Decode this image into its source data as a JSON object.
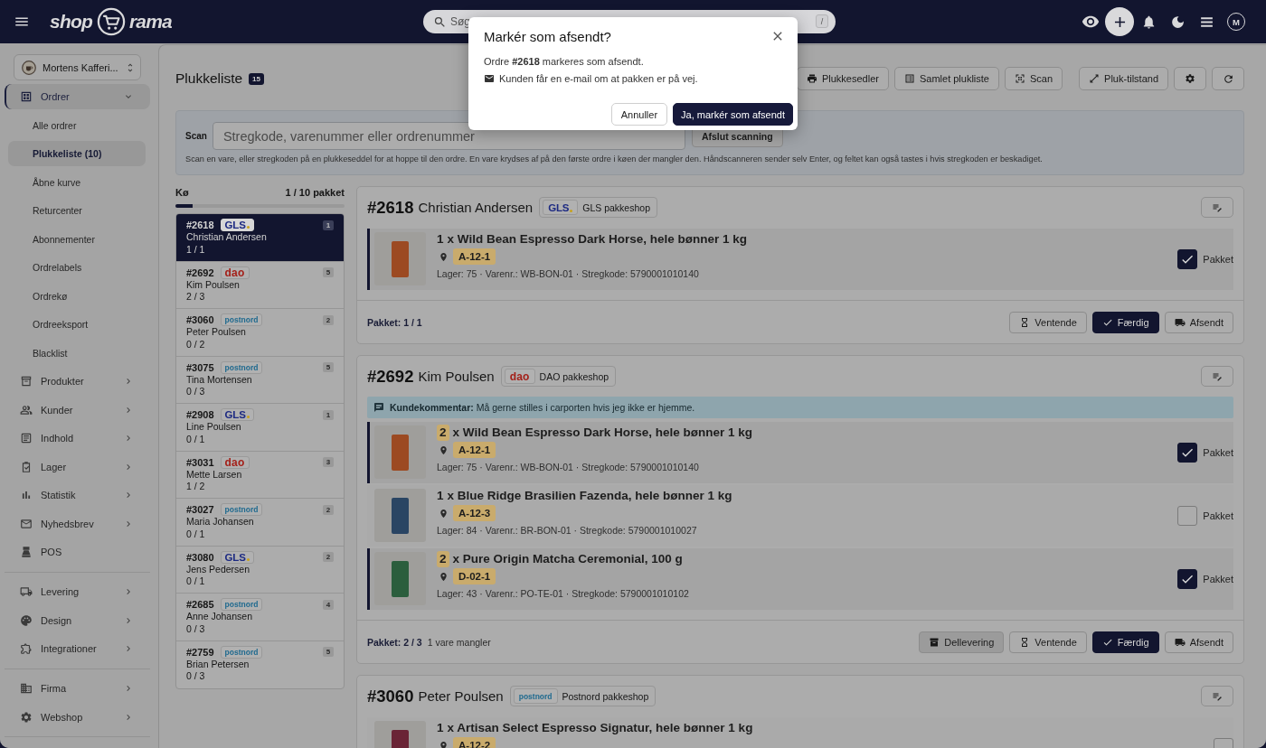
{
  "header": {
    "logo": {
      "left": "shop",
      "right": "rama"
    },
    "search": {
      "placeholder": "Søg",
      "shortcut": "/"
    },
    "avatar": "M"
  },
  "sidebar": {
    "store": "Mortens Kafferi...",
    "sections": [
      [
        {
          "label": "Ordrer",
          "expanded": true,
          "selected": true,
          "children": [
            {
              "label": "Alle ordrer",
              "selected": false
            },
            {
              "label": "Plukkeliste (10)",
              "selected": true
            },
            {
              "label": "Åbne kurve",
              "selected": false
            },
            {
              "label": "Returcenter",
              "selected": false
            },
            {
              "label": "Abonnementer",
              "selected": false
            },
            {
              "label": "Ordrelabels",
              "selected": false
            },
            {
              "label": "Ordrekø",
              "selected": false
            },
            {
              "label": "Ordreeksport",
              "selected": false
            },
            {
              "label": "Blacklist",
              "selected": false
            }
          ]
        },
        {
          "label": "Produkter",
          "expanded": false,
          "selected": false
        },
        {
          "label": "Kunder",
          "expanded": false,
          "selected": false
        },
        {
          "label": "Indhold",
          "expanded": false,
          "selected": false
        },
        {
          "label": "Lager",
          "expanded": false,
          "selected": false
        },
        {
          "label": "Statistik",
          "expanded": false,
          "selected": false
        },
        {
          "label": "Nyhedsbrev",
          "expanded": false,
          "selected": false
        },
        {
          "label": "POS",
          "selected": false
        }
      ],
      [
        {
          "label": "Levering",
          "expanded": false,
          "selected": false
        },
        {
          "label": "Design",
          "expanded": false,
          "selected": false
        },
        {
          "label": "Integrationer",
          "expanded": false,
          "selected": false
        }
      ],
      [
        {
          "label": "Firma",
          "expanded": false,
          "selected": false
        },
        {
          "label": "Webshop",
          "expanded": false,
          "selected": false
        }
      ]
    ]
  },
  "page": {
    "title": "Plukkeliste",
    "count": "15",
    "toolbar": [
      {
        "label": "Plukkesedler"
      },
      {
        "label": "Samlet plukliste"
      },
      {
        "label": "Scan"
      },
      {
        "label": "Pluk-tilstand"
      }
    ]
  },
  "scan": {
    "label": "Scan",
    "placeholder": "Stregkode, varenummer eller ordrenummer",
    "button": "Afslut scanning",
    "help": "Scan en vare, eller stregkoden på en plukkeseddel for at hoppe til den ordre. En vare krydses af på den første ordre i køen der mangler den. Håndscanneren sender selv Enter, og feltet kan også tastes i hvis stregkoden er beskadiget."
  },
  "queue": {
    "title": "Kø",
    "summary": "1 / 10 pakket",
    "level": 0.1,
    "orders": [
      {
        "number": "#2618",
        "kind": "gls",
        "carrier_logo": "GLS",
        "count": "1",
        "customer": "Christian Andersen",
        "progress": "1 / 1",
        "selected": true
      },
      {
        "number": "#2692",
        "kind": "dao",
        "carrier_logo": "dao",
        "count": "5",
        "customer": "Kim Poulsen",
        "progress": "2 / 3",
        "selected": false
      },
      {
        "number": "#3060",
        "kind": "postnord",
        "carrier_logo": "postnord",
        "count": "2",
        "customer": "Peter Poulsen",
        "progress": "0 / 2",
        "selected": false
      },
      {
        "number": "#3075",
        "kind": "postnord",
        "carrier_logo": "postnord",
        "count": "5",
        "customer": "Tina Mortensen",
        "progress": "0 / 3",
        "selected": false
      },
      {
        "number": "#2908",
        "kind": "gls",
        "carrier_logo": "GLS",
        "count": "1",
        "customer": "Line Poulsen",
        "progress": "0 / 1",
        "selected": false
      },
      {
        "number": "#3031",
        "kind": "dao",
        "carrier_logo": "dao",
        "count": "3",
        "customer": "Mette Larsen",
        "progress": "1 / 2",
        "selected": false
      },
      {
        "number": "#3027",
        "kind": "postnord",
        "carrier_logo": "postnord",
        "count": "2",
        "customer": "Maria Johansen",
        "progress": "0 / 1",
        "selected": false
      },
      {
        "number": "#3080",
        "kind": "gls",
        "carrier_logo": "GLS",
        "count": "2",
        "customer": "Jens Pedersen",
        "progress": "0 / 1",
        "selected": false
      },
      {
        "number": "#2685",
        "kind": "postnord",
        "carrier_logo": "postnord",
        "count": "4",
        "customer": "Anne Johansen",
        "progress": "0 / 3",
        "selected": false
      },
      {
        "number": "#2759",
        "kind": "postnord",
        "carrier_logo": "postnord",
        "count": "5",
        "customer": "Brian Petersen",
        "progress": "0 / 3",
        "selected": false
      }
    ]
  },
  "orders": [
    {
      "number": "#2618",
      "customer": "Christian Andersen",
      "kind": "gls",
      "carrier_logo": "GLS",
      "shipping": "GLS pakkeshop",
      "items": [
        {
          "qty": "1",
          "qty_highlighted": false,
          "title": "x Wild Bean Espresso Dark Horse, hele bønner 1 kg",
          "location": "A-12-1",
          "meta": "Lager: 75 · Varenr.: WB-BON-01 · Stregkode: 5790001010140",
          "packed": true,
          "check_label": "Pakket",
          "color": "#9c4a22"
        }
      ],
      "footer": {
        "summary": "Pakket: 1 / 1"
      },
      "actions": [
        {
          "label": "Ventende",
          "kind": "waiting",
          "selected": false
        },
        {
          "label": "Færdig",
          "kind": "done",
          "selected": true
        },
        {
          "label": "Afsendt",
          "kind": "shipped",
          "selected": false
        }
      ]
    },
    {
      "number": "#2692",
      "customer": "Kim Poulsen",
      "kind": "dao",
      "carrier_logo": "dao",
      "shipping": "DAO pakkeshop",
      "comment": "**Kundekommentar:** Må gerne stilles i carporten hvis jeg ikke er hjemme.",
      "items": [
        {
          "qty": "2",
          "qty_highlighted": true,
          "title": "x Wild Bean Espresso Dark Horse, hele bønner 1 kg",
          "location": "A-12-1",
          "meta": "Lager: 75 · Varenr.: WB-BON-01 · Stregkode: 5790001010140",
          "packed": true,
          "check_label": "Pakket",
          "color": "#9c4a22"
        },
        {
          "qty": "1",
          "qty_highlighted": false,
          "title": "x Blue Ridge Brasilien Fazenda, hele bønner 1 kg",
          "location": "A-12-3",
          "meta": "Lager: 84 · Varenr.: BR-BON-01 · Stregkode: 5790001010027",
          "packed": false,
          "check_label": "Pakket",
          "color": "#2a4563"
        },
        {
          "qty": "2",
          "qty_highlighted": true,
          "title": "x Pure Origin Matcha Ceremonial, 100 g",
          "location": "D-02-1",
          "meta": "Lager: 43 · Varenr.: PO-TE-01 · Stregkode: 5790001010102",
          "packed": true,
          "check_label": "Pakket",
          "color": "#2b5e3d"
        }
      ],
      "footer": {
        "summary": "Pakket: 2 / 3",
        "missing": "1 vare mangler"
      },
      "actions": [
        {
          "label": "Dellevering",
          "kind": "partial",
          "selected": false
        },
        {
          "label": "Ventende",
          "kind": "waiting",
          "selected": false
        },
        {
          "label": "Færdig",
          "kind": "done",
          "selected": true
        },
        {
          "label": "Afsendt",
          "kind": "shipped",
          "selected": false
        }
      ]
    },
    {
      "number": "#3060",
      "customer": "Peter Poulsen",
      "kind": "postnord",
      "carrier_logo": "postnord",
      "shipping": "Postnord pakkeshop",
      "items": [
        {
          "qty": "1",
          "qty_highlighted": false,
          "title": "x Artisan Select Espresso Signatur, hele bønner 1 kg",
          "location": "A-12-2",
          "packed": false,
          "color": "#6a2436"
        }
      ]
    }
  ],
  "modal": {
    "title": "Markér som afsendt?",
    "message": "Ordre **#2618** markeres som afsendt.",
    "note": "Kunden får en e-mail om at pakken er på vej.",
    "buttons": [
      {
        "label": "Annuller",
        "kind": "secondary"
      },
      {
        "label": "Ja, markér som afsendt",
        "kind": "primary"
      }
    ]
  }
}
